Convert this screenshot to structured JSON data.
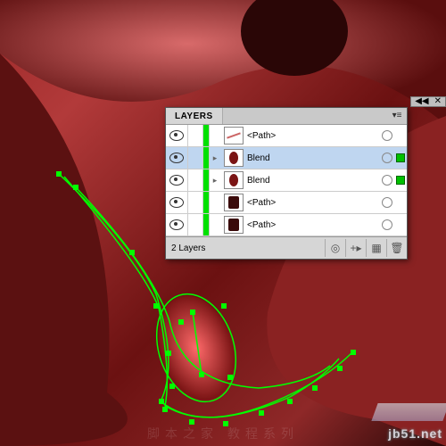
{
  "panel": {
    "title": "LAYERS",
    "layer_count_label": "2 Layers",
    "rows": [
      {
        "name": "<Path>",
        "thumb": "tline",
        "selected_art": false,
        "highlighted": false,
        "expand": ""
      },
      {
        "name": "Blend",
        "thumb": "tblob",
        "selected_art": true,
        "highlighted": true,
        "expand": "▸"
      },
      {
        "name": "Blend",
        "thumb": "tblob",
        "selected_art": true,
        "highlighted": false,
        "expand": "▸"
      },
      {
        "name": "<Path>",
        "thumb": "tdark",
        "selected_art": false,
        "highlighted": false,
        "expand": ""
      },
      {
        "name": "<Path>",
        "thumb": "tdark",
        "selected_art": false,
        "highlighted": false,
        "expand": ""
      }
    ],
    "footer_icons": [
      "target",
      "new-sublayer",
      "new-layer",
      "trash"
    ]
  },
  "collapse_bar": {
    "left": "◀◀",
    "right": "✕"
  },
  "watermark": {
    "site": "jb51.net",
    "bg_label": "脚本之家 教程系列"
  }
}
